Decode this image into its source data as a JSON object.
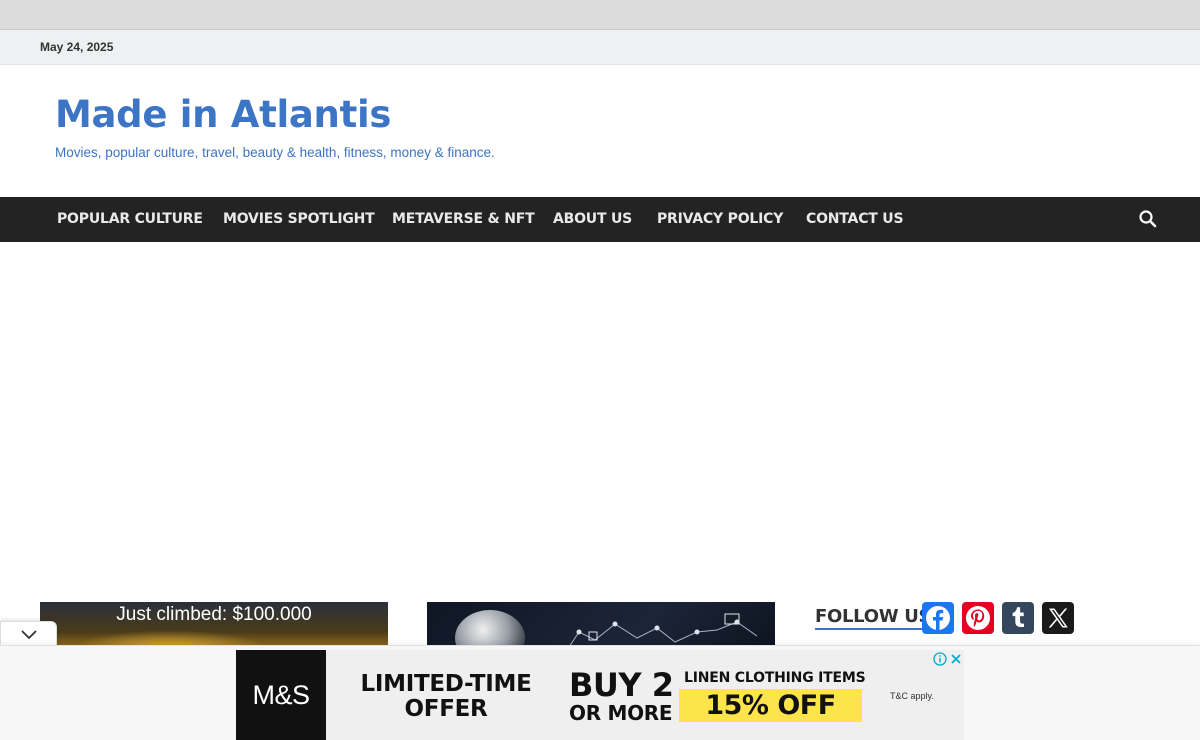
{
  "topbar": {
    "date": "May 24, 2025"
  },
  "header": {
    "site_title": "Made in Atlantis",
    "site_description": "Movies, popular culture, travel, beauty & health, fitness, money & finance."
  },
  "nav": {
    "items": [
      {
        "label": "POPULAR CULTURE"
      },
      {
        "label": "MOVIES SPOTLIGHT"
      },
      {
        "label": "METAVERSE & NFT"
      },
      {
        "label": "ABOUT US"
      },
      {
        "label": "PRIVACY POLICY"
      },
      {
        "label": "CONTACT US"
      }
    ],
    "search_icon": "search-icon"
  },
  "posts": [
    {
      "caption": "Just climbed: $100.000"
    }
  ],
  "sidebar": {
    "follow_title": "FOLLOW US",
    "social": [
      {
        "name": "Facebook",
        "icon": "facebook-icon",
        "color": "#1877f2"
      },
      {
        "name": "Pinterest",
        "icon": "pinterest-icon",
        "color": "#e60023"
      },
      {
        "name": "Tumblr",
        "icon": "tumblr-icon",
        "color": "#35465d"
      },
      {
        "name": "X",
        "icon": "x-icon",
        "color": "#1a1a1a"
      }
    ]
  },
  "ad": {
    "brand": "M&S",
    "offer_line1": "LIMITED-TIME",
    "offer_line2": "OFFER",
    "buy": "BUY 2",
    "or_more": "OR MORE",
    "linen": "LINEN CLOTHING ITEMS",
    "discount": "15% OFF",
    "terms": "T&C apply.",
    "accent_color": "#fde44a"
  },
  "colors": {
    "brand_blue": "#3c74c6",
    "nav_bg": "#232323",
    "topbar_bg": "#eef1f2"
  }
}
